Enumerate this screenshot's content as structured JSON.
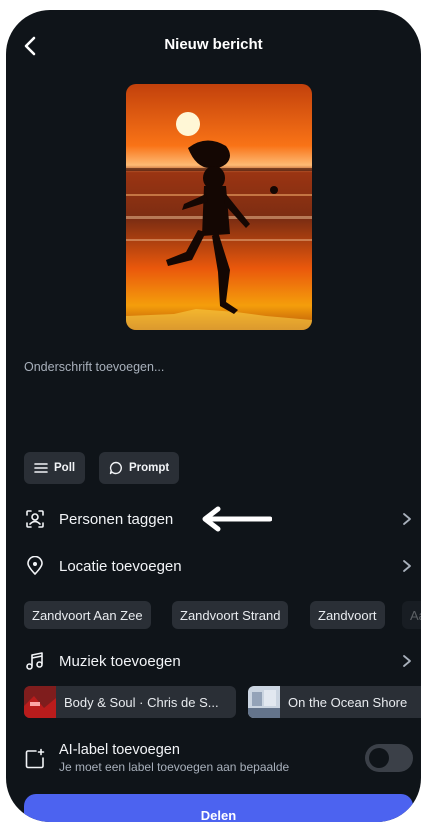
{
  "header": {
    "title": "Nieuw bericht",
    "back_icon": "chevron-left-icon"
  },
  "photo": {
    "description_icon": "photo"
  },
  "caption": {
    "placeholder": "Onderschrift toevoegen..."
  },
  "chips": [
    {
      "label": "Poll",
      "icon": "list-icon"
    },
    {
      "label": "Prompt",
      "icon": "speech-bubble-icon"
    }
  ],
  "rows": {
    "tag": {
      "label": "Personen taggen",
      "icon": "tag-person-icon"
    },
    "location": {
      "label": "Locatie toevoegen",
      "icon": "location-pin-icon"
    },
    "music": {
      "label": "Muziek toevoegen",
      "icon": "music-note-icon"
    }
  },
  "location_suggestions": [
    "Zandvoort Aan Zee",
    "Zandvoort Strand",
    "Zandvoort",
    "Aa"
  ],
  "music_suggestions": [
    "Body & Soul · Chris de S...",
    "On the Ocean Shore"
  ],
  "ai_label": {
    "title": "AI-label toevoegen",
    "subtitle": "Je moet een label toevoegen aan bepaalde",
    "enabled": false
  },
  "share": {
    "label": "Delen"
  },
  "annotation": {
    "arrow": "white-arrow-left"
  },
  "colors": {
    "background": "#0f1419",
    "chip": "#2a2f36",
    "accent": "#4c63f0"
  }
}
